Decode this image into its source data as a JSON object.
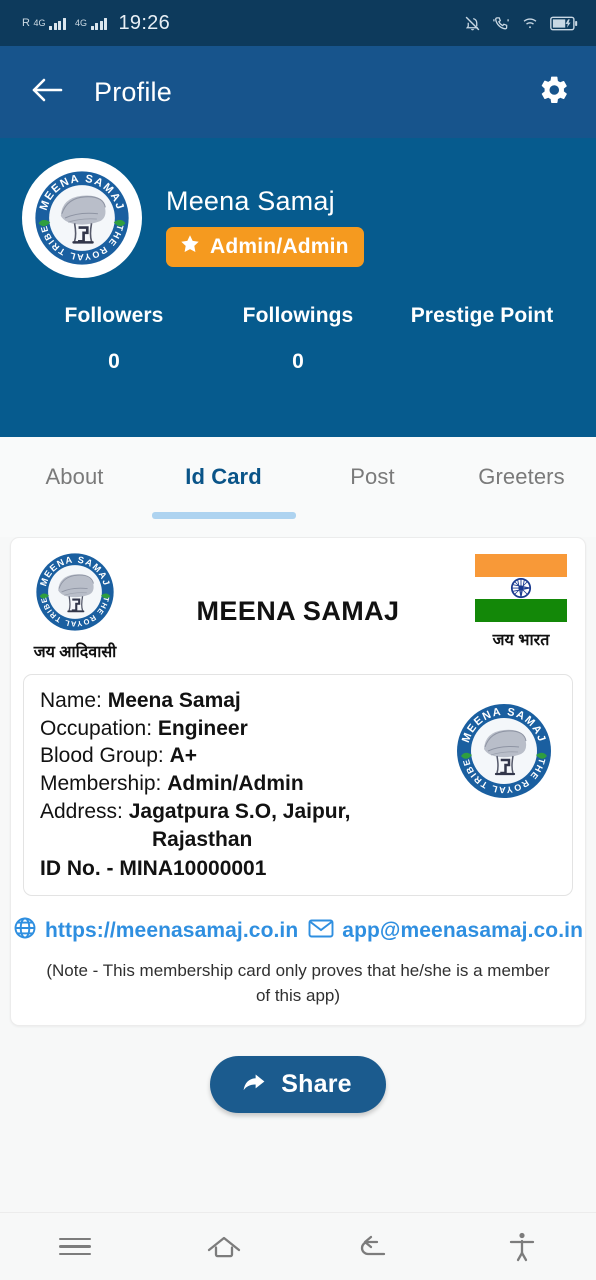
{
  "status_bar": {
    "roaming": "R",
    "network_1": "4G",
    "network_2": "4G",
    "time": "19:26",
    "icons": [
      "mute-bell-icon",
      "vibrate-call-icon",
      "wifi-icon",
      "battery-icon"
    ]
  },
  "app_bar": {
    "back_icon": "back-arrow-icon",
    "title": "Profile",
    "settings_icon": "gear-icon"
  },
  "profile": {
    "avatar_alt": "Meena Samaj logo",
    "name": "Meena Samaj",
    "badge": {
      "icon": "star-icon",
      "label": "Admin/Admin",
      "color": "#f59a1f"
    },
    "stats": [
      {
        "label": "Followers",
        "value": "0"
      },
      {
        "label": "Followings",
        "value": "0"
      },
      {
        "label": "Prestige Point",
        "value": ""
      }
    ]
  },
  "tabs": [
    {
      "label": "About",
      "active": false
    },
    {
      "label": "Id Card",
      "active": true
    },
    {
      "label": "Post",
      "active": false
    },
    {
      "label": "Greeters",
      "active": false
    }
  ],
  "id_card": {
    "left_caption": "जय आदिवासी",
    "title": "MEENA SAMAJ",
    "right_caption": "जय भारत",
    "flag": {
      "saffron": "#f89938",
      "white": "#ffffff",
      "green": "#138808",
      "chakra": "#1a3a8f"
    },
    "fields": [
      {
        "key": "Name:",
        "value": "Meena Samaj"
      },
      {
        "key": "Occupation:",
        "value": "Engineer"
      },
      {
        "key": "Blood Group:",
        "value": "A+"
      },
      {
        "key": "Membership:",
        "value": "Admin/Admin"
      },
      {
        "key": "Address:",
        "value": "Jagatpura S.O, Jaipur,"
      }
    ],
    "address_line2": "Rajasthan",
    "id_no": "ID No. - MINA10000001",
    "website": {
      "icon": "globe-icon",
      "text": "https://meenasamaj.co.in"
    },
    "email": {
      "icon": "envelope-icon",
      "text": "app@meenasamaj.co.in"
    },
    "note": "(Note - This membership card only proves that he/she is a member of this app)",
    "link_color": "#2f8fe0"
  },
  "share_button": {
    "icon": "share-arrow-icon",
    "label": "Share",
    "color": "#1b5b8e"
  },
  "nav_bar": {
    "items": [
      "recents-menu-icon",
      "home-icon",
      "back-icon",
      "accessibility-icon"
    ]
  },
  "logo": {
    "top_arc": "MEENA SAMAJ",
    "bottom_arc": "THE ROYAL TRIBE"
  },
  "theme": {
    "status_bar_bg": "#0d3a5c",
    "app_bar_bg": "#17548c",
    "profile_bg": "#065b8e",
    "page_bg": "#f7f8f8",
    "active_tab": "#0a5488"
  }
}
